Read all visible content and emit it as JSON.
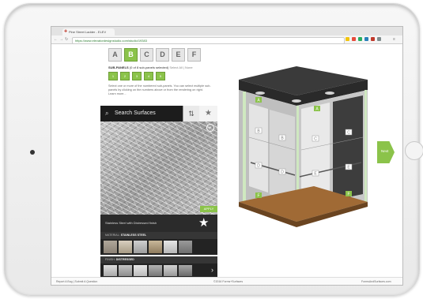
{
  "browser": {
    "tab_title": "Pine Street Ladder - ELEV",
    "url": "https://www.elevatordesignstudio.com/studio/19383"
  },
  "panel": {
    "letters": [
      {
        "label": "A",
        "active": false
      },
      {
        "label": "B",
        "active": true
      },
      {
        "label": "C",
        "active": false
      },
      {
        "label": "D",
        "active": false
      },
      {
        "label": "E",
        "active": false
      },
      {
        "label": "F",
        "active": false
      }
    ],
    "subpanels_title": "SUB-PANELS",
    "subpanels_count": "(0 of 8 sub-panels selected)",
    "subpanels_links": "Select All | None",
    "subpanel_buttons": [
      "1",
      "2",
      "3",
      "4",
      "5"
    ],
    "description": "Select one or more of the numbered sub-panels. You can select multiple sub-panels by clicking on the numbers above or from the rendering on right. Learn more...",
    "search_placeholder": "Search Surfaces",
    "apply_label": "APPLY",
    "surface_name": "Stainless Steel with Distressed finish",
    "material_label": "MATERIAL:",
    "material_value": "STAINLESS STEEL",
    "finish_label": "FINISH:",
    "finish_value": "DISTRESSED"
  },
  "elevator": {
    "next_label": "Next",
    "sub_labels": [
      "A",
      "A",
      "B",
      "B",
      "C",
      "C",
      "D",
      "D",
      "E",
      "E",
      "F",
      "F"
    ]
  },
  "footer": {
    "left": "Report A Bug | Submit A Question",
    "center": "©2016 Forms+Surfaces",
    "right": "FormsAndSurfaces.com"
  },
  "colors": {
    "accent": "#8bc34a",
    "dark": "#1c1c1c"
  },
  "icons": [
    "back-arrow-icon",
    "forward-arrow-icon",
    "reload-icon",
    "home-icon",
    "search-icon",
    "filter-icon",
    "star-icon",
    "zoom-icon",
    "next-chevron-icon"
  ]
}
